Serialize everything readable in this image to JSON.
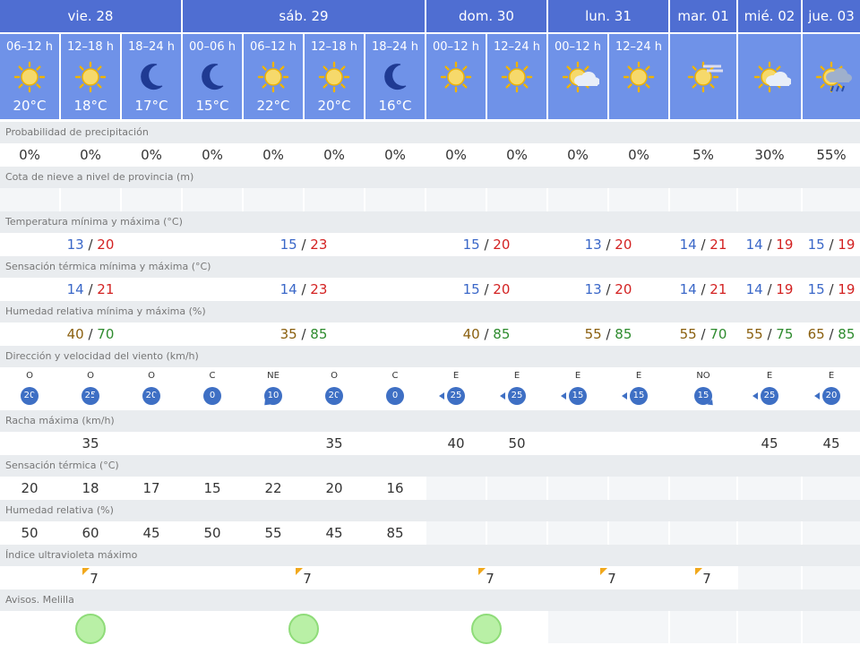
{
  "days": [
    {
      "label": "vie. 28"
    },
    {
      "label": "sáb. 29"
    },
    {
      "label": "dom. 30"
    },
    {
      "label": "lun. 31"
    },
    {
      "label": "mar. 01"
    },
    {
      "label": "mié. 02"
    },
    {
      "label": "jue. 03"
    }
  ],
  "periods": [
    {
      "label": "06–12 h",
      "icon": "sun-icon",
      "temp": "20°C"
    },
    {
      "label": "12–18 h",
      "icon": "sun-icon",
      "temp": "18°C"
    },
    {
      "label": "18–24 h",
      "icon": "moon-icon",
      "temp": "17°C"
    },
    {
      "label": "00–06 h",
      "icon": "moon-icon",
      "temp": "15°C"
    },
    {
      "label": "06–12 h",
      "icon": "sun-icon",
      "temp": "22°C"
    },
    {
      "label": "12–18 h",
      "icon": "sun-icon",
      "temp": "20°C"
    },
    {
      "label": "18–24 h",
      "icon": "moon-icon",
      "temp": "16°C"
    },
    {
      "label": "00–12 h",
      "icon": "sun-icon",
      "temp": ""
    },
    {
      "label": "12–24 h",
      "icon": "sun-icon",
      "temp": ""
    },
    {
      "label": "00–12 h",
      "icon": "sun-cloud-icon",
      "temp": ""
    },
    {
      "label": "12–24 h",
      "icon": "sun-icon",
      "temp": ""
    },
    {
      "label": "",
      "icon": "sun-haze-icon",
      "temp": ""
    },
    {
      "label": "",
      "icon": "sun-cloud-icon",
      "temp": ""
    },
    {
      "label": "",
      "icon": "sun-rain-icon",
      "temp": ""
    }
  ],
  "sections": {
    "precip": "Probabilidad de precipitación",
    "snow": "Cota de nieve a nivel de provincia (m)",
    "temp": "Temperatura mínima y máxima (°C)",
    "feels": "Sensación térmica mínima y máxima (°C)",
    "humid": "Humedad relativa mínima y máxima (%)",
    "wind": "Dirección y velocidad del viento (km/h)",
    "gust": "Racha máxima (km/h)",
    "feels_single": "Sensación térmica (°C)",
    "humid_single": "Humedad relativa (%)",
    "uv": "Índice ultravioleta máximo",
    "avisos": "Avisos. Melilla"
  },
  "precip": [
    "0%",
    "0%",
    "0%",
    "0%",
    "0%",
    "0%",
    "0%",
    "0%",
    "0%",
    "0%",
    "0%",
    "5%",
    "30%",
    "55%"
  ],
  "temp_minmax": [
    {
      "min": "13",
      "max": "20"
    },
    {
      "min": "15",
      "max": "23"
    },
    {
      "min": "15",
      "max": "20"
    },
    {
      "min": "13",
      "max": "20"
    },
    {
      "min": "14",
      "max": "21"
    },
    {
      "min": "14",
      "max": "19"
    },
    {
      "min": "15",
      "max": "19"
    }
  ],
  "feels_minmax": [
    {
      "min": "14",
      "max": "21"
    },
    {
      "min": "14",
      "max": "23"
    },
    {
      "min": "15",
      "max": "20"
    },
    {
      "min": "13",
      "max": "20"
    },
    {
      "min": "14",
      "max": "21"
    },
    {
      "min": "14",
      "max": "19"
    },
    {
      "min": "15",
      "max": "19"
    }
  ],
  "humid_minmax": [
    {
      "min": "40",
      "max": "70"
    },
    {
      "min": "35",
      "max": "85"
    },
    {
      "min": "40",
      "max": "85"
    },
    {
      "min": "55",
      "max": "85"
    },
    {
      "min": "55",
      "max": "70"
    },
    {
      "min": "55",
      "max": "75"
    },
    {
      "min": "65",
      "max": "85"
    }
  ],
  "wind": [
    {
      "dir": "O",
      "speed": "20",
      "arrow": "right"
    },
    {
      "dir": "O",
      "speed": "25",
      "arrow": "right"
    },
    {
      "dir": "O",
      "speed": "20",
      "arrow": "right"
    },
    {
      "dir": "C",
      "speed": "0",
      "arrow": ""
    },
    {
      "dir": "NE",
      "speed": "10",
      "arrow": "sw"
    },
    {
      "dir": "O",
      "speed": "20",
      "arrow": "right"
    },
    {
      "dir": "C",
      "speed": "0",
      "arrow": ""
    },
    {
      "dir": "E",
      "speed": "25",
      "arrow": "left"
    },
    {
      "dir": "E",
      "speed": "25",
      "arrow": "left"
    },
    {
      "dir": "E",
      "speed": "15",
      "arrow": "left"
    },
    {
      "dir": "E",
      "speed": "15",
      "arrow": "left"
    },
    {
      "dir": "NO",
      "speed": "15",
      "arrow": "se"
    },
    {
      "dir": "E",
      "speed": "25",
      "arrow": "left"
    },
    {
      "dir": "E",
      "speed": "20",
      "arrow": "left"
    }
  ],
  "gust": [
    "",
    "35",
    "",
    "",
    "",
    "35",
    "",
    "40",
    "50",
    "",
    "",
    "",
    "45",
    "45"
  ],
  "feels_single": [
    "20",
    "18",
    "17",
    "15",
    "22",
    "20",
    "16",
    "",
    "",
    "",
    "",
    "",
    "",
    ""
  ],
  "humid_single": [
    "50",
    "60",
    "45",
    "50",
    "55",
    "45",
    "85",
    "",
    "",
    "",
    "",
    "",
    "",
    ""
  ],
  "uv": [
    "7",
    "7",
    "7",
    "7",
    "7",
    "",
    ""
  ],
  "avisos": [
    "green",
    "green",
    "green",
    "",
    "",
    "",
    ""
  ],
  "colors": {
    "header": "#4f6ed2",
    "subheader": "#6f92e8",
    "min": "#3a67c8",
    "max_temp": "#d32222",
    "min_humid": "#8a5f0e",
    "max_humid": "#2e8b2e",
    "aviso_green": "#b9f0a6"
  }
}
